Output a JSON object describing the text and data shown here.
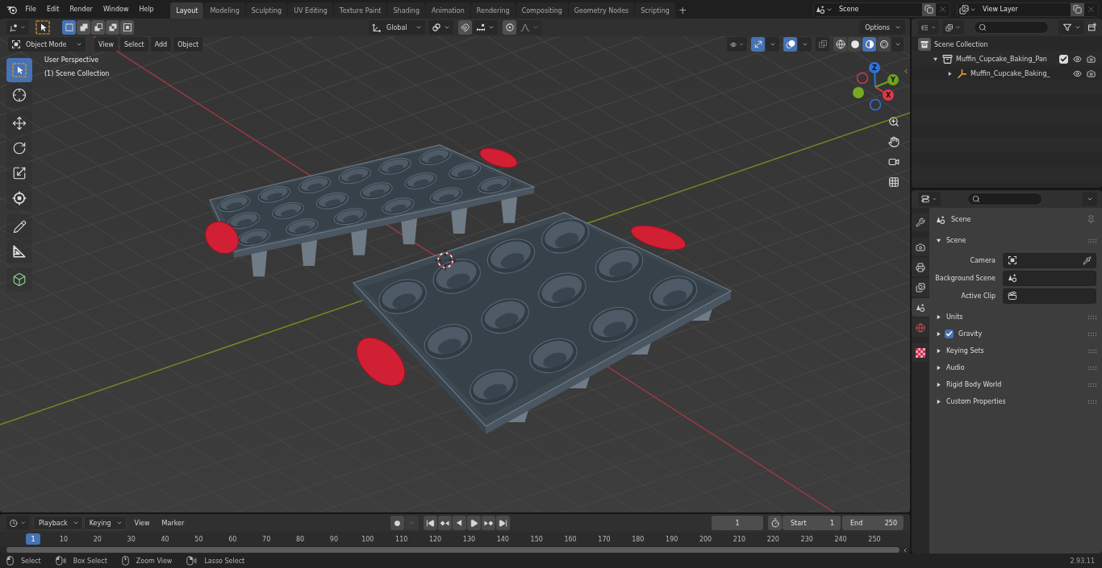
{
  "top_bar": {
    "menus": [
      "File",
      "Edit",
      "Render",
      "Window",
      "Help"
    ],
    "workspaces": [
      {
        "label": "Layout",
        "selected": true
      },
      {
        "label": "Modeling",
        "selected": false
      },
      {
        "label": "Sculpting",
        "selected": false
      },
      {
        "label": "UV Editing",
        "selected": false
      },
      {
        "label": "Texture Paint",
        "selected": false
      },
      {
        "label": "Shading",
        "selected": false
      },
      {
        "label": "Animation",
        "selected": false
      },
      {
        "label": "Rendering",
        "selected": false
      },
      {
        "label": "Compositing",
        "selected": false
      },
      {
        "label": "Geometry Nodes",
        "selected": false
      },
      {
        "label": "Scripting",
        "selected": false
      }
    ],
    "add_workspace": "+",
    "scene": "Scene",
    "view_layer": "View Layer"
  },
  "viewport": {
    "select_modes": [
      {
        "kind": "set",
        "selected": true
      },
      {
        "kind": "extend",
        "selected": false
      },
      {
        "kind": "subtract",
        "selected": false
      },
      {
        "kind": "difference",
        "selected": false
      },
      {
        "kind": "intersect",
        "selected": false
      }
    ],
    "orientation": "Global",
    "snap_on": false,
    "proportional_on": false,
    "options": "Options",
    "mode": "Object Mode",
    "menus": [
      "View",
      "Select",
      "Add",
      "Object"
    ],
    "gizmos_on": true,
    "overlays_on": true,
    "xray_on": false,
    "shading": [
      {
        "kind": "wireframe",
        "selected": false
      },
      {
        "kind": "solid",
        "selected": false
      },
      {
        "kind": "material",
        "selected": true
      },
      {
        "kind": "rendered",
        "selected": false
      }
    ],
    "tool_groups": [
      [
        {
          "kind": "select_box",
          "selected": true
        },
        {
          "kind": "cursor",
          "selected": false
        }
      ],
      [
        {
          "kind": "move",
          "selected": false
        },
        {
          "kind": "rotate",
          "selected": false
        },
        {
          "kind": "scale",
          "selected": false
        },
        {
          "kind": "transform",
          "selected": false
        }
      ],
      [
        {
          "kind": "annotate",
          "selected": false
        },
        {
          "kind": "measure",
          "selected": false
        }
      ],
      [
        {
          "kind": "add_cube",
          "selected": false
        }
      ]
    ],
    "view_name": "User Perspective",
    "collection_name": "(1) Scene Collection",
    "axes": [
      "Z",
      "Y",
      "X"
    ]
  },
  "outliner": {
    "tree": [
      {
        "kind": "scene_collection",
        "label": "Scene Collection",
        "children": [
          {
            "kind": "collection",
            "label": "Muffin_Cupcake_Baking_Pan",
            "expanded": true,
            "checked": true,
            "children": [
              {
                "kind": "object",
                "label": "Muffin_Cupcake_Baking_",
                "expanded": false
              }
            ]
          }
        ]
      }
    ]
  },
  "properties": {
    "tabs": [
      [
        {
          "kind": "tool",
          "selected": false
        }
      ],
      [
        {
          "kind": "render",
          "selected": false
        },
        {
          "kind": "output",
          "selected": false
        },
        {
          "kind": "view_layer",
          "selected": false
        },
        {
          "kind": "scene",
          "selected": true
        },
        {
          "kind": "world",
          "selected": false
        }
      ],
      [
        {
          "kind": "texture",
          "selected": false
        }
      ]
    ],
    "context": "Scene",
    "panels": [
      {
        "label": "Scene",
        "expanded": true,
        "fields": [
          {
            "kind": "camera",
            "label": "Camera"
          },
          {
            "kind": "scene",
            "label": "Background Scene"
          },
          {
            "kind": "clip",
            "label": "Active Clip"
          }
        ]
      },
      {
        "label": "Units",
        "expanded": false
      },
      {
        "label": "Gravity",
        "expanded": false,
        "checked": true
      },
      {
        "label": "Keying Sets",
        "expanded": false
      },
      {
        "label": "Audio",
        "expanded": false
      },
      {
        "label": "Rigid Body World",
        "expanded": false
      },
      {
        "label": "Custom Properties",
        "expanded": false
      }
    ]
  },
  "timeline": {
    "menus": [
      {
        "kind": "dropdown",
        "label": "Playback"
      },
      {
        "kind": "dropdown",
        "label": "Keying"
      },
      {
        "kind": "menu",
        "label": "View"
      },
      {
        "kind": "menu",
        "label": "Marker"
      }
    ],
    "current_frame": "1",
    "start_label": "Start",
    "start": "1",
    "end_label": "End",
    "end": "250",
    "playhead": "1",
    "ruler": [
      "10",
      "20",
      "30",
      "40",
      "50",
      "60",
      "70",
      "80",
      "90",
      "100",
      "110",
      "120",
      "130",
      "140",
      "150",
      "160",
      "170",
      "180",
      "190",
      "200",
      "210",
      "220",
      "230",
      "240",
      "250"
    ]
  },
  "status_bar": {
    "hints": [
      {
        "kind": "lmb",
        "label": "Select"
      },
      {
        "kind": "lmb_drag",
        "label": "Box Select"
      },
      {
        "kind": "mmb",
        "label": "Zoom View"
      },
      {
        "kind": "rmb_drag",
        "label": "Lasso Select"
      }
    ],
    "version": "2.93.11"
  }
}
